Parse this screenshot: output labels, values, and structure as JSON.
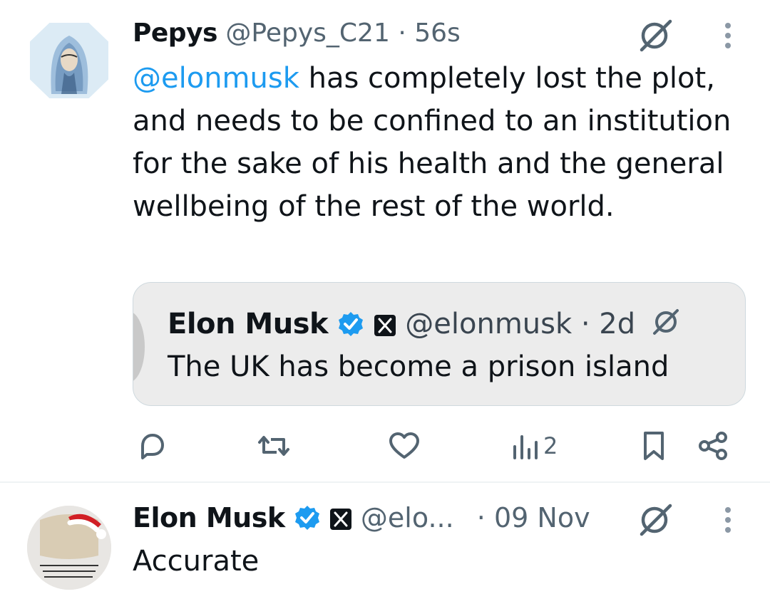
{
  "tweet1": {
    "name": "Pepys",
    "handle": "@Pepys_C21",
    "sep": "·",
    "time": "56s",
    "mention": "@elonmusk",
    "text": " has completely lost the plot, and needs to be confined to an institution for the sake of his health and the general wellbeing of the rest of the world.",
    "quote": {
      "name": "Elon Musk",
      "handle": "@elonmusk",
      "sep": "·",
      "time": "2d",
      "text": "The UK has become a prison island"
    },
    "actions": {
      "reply_icon": "reply-icon",
      "retweet_icon": "retweet-icon",
      "like_icon": "heart-icon",
      "views_icon": "views-icon",
      "views_count": "2",
      "bookmark_icon": "bookmark-icon",
      "share_icon": "share-icon"
    }
  },
  "tweet2": {
    "name": "Elon Musk",
    "handle": "@elo...",
    "sep": "·",
    "time": "09 Nov",
    "text": "Accurate"
  },
  "colors": {
    "link": "#1d9bf0",
    "meta": "#536471",
    "text": "#0f1419",
    "verified": "#1d9bf0"
  }
}
